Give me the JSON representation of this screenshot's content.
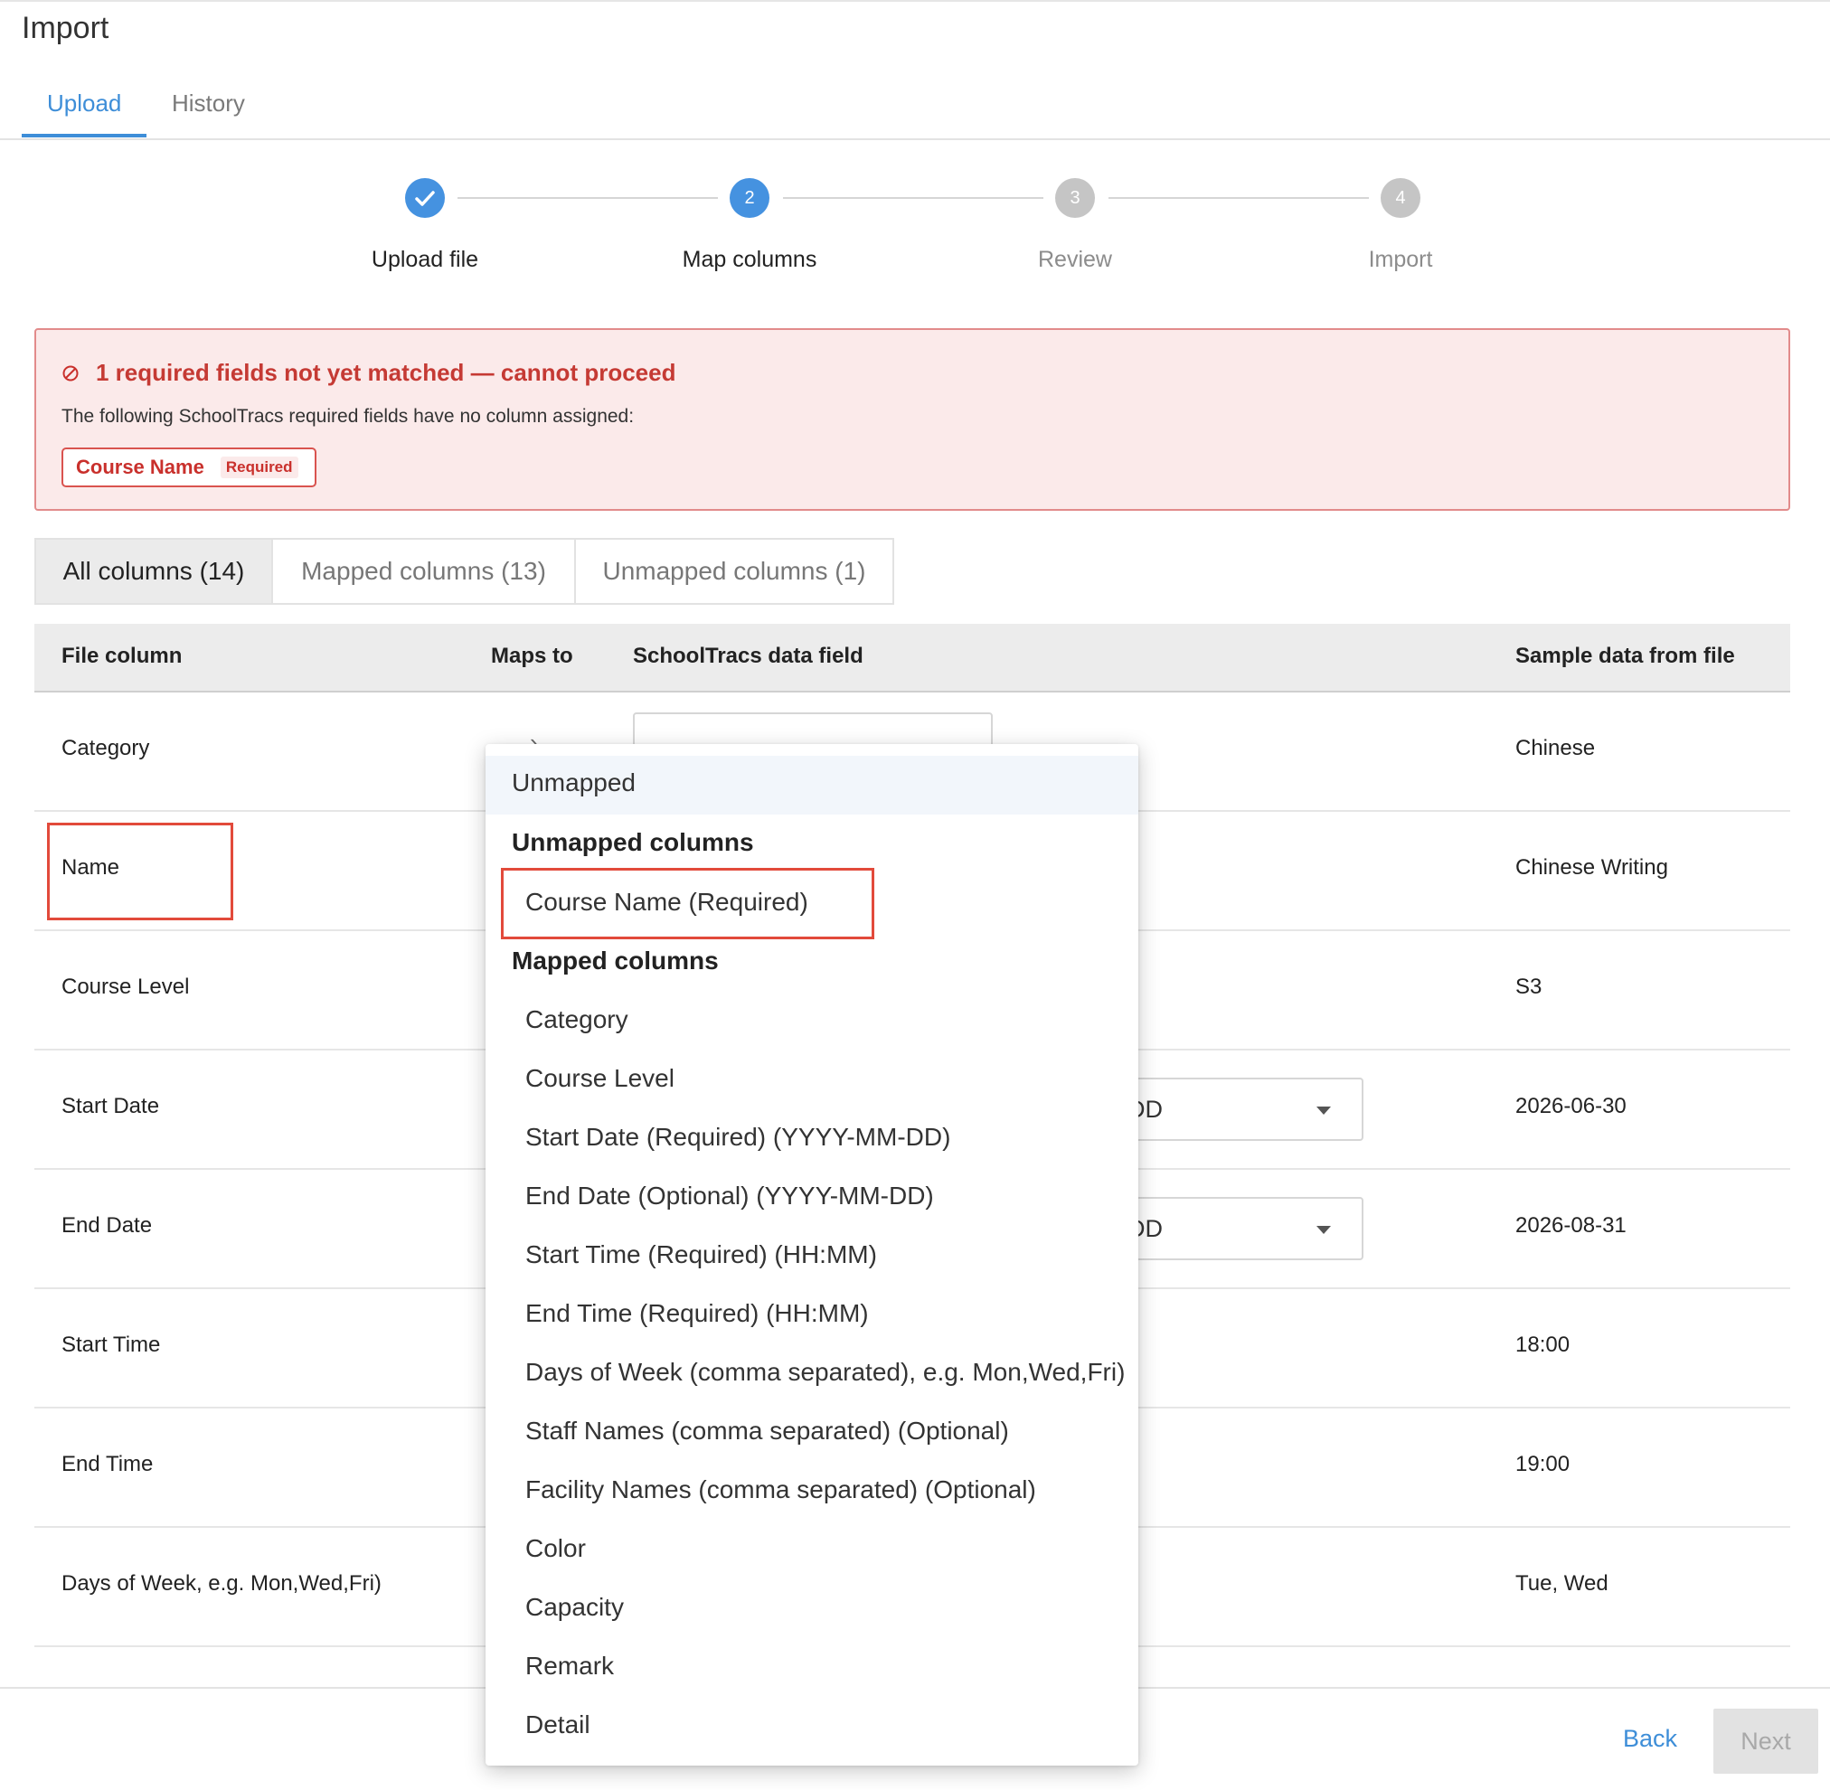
{
  "page": {
    "title": "Import"
  },
  "tabs": {
    "upload": "Upload",
    "history": "History"
  },
  "stepper": {
    "steps": [
      {
        "label": "Upload file",
        "number": "1",
        "state": "done"
      },
      {
        "label": "Map columns",
        "number": "2",
        "state": "current"
      },
      {
        "label": "Review",
        "number": "3",
        "state": "todo"
      },
      {
        "label": "Import",
        "number": "4",
        "state": "todo"
      }
    ]
  },
  "alert": {
    "icon": "ban-icon",
    "title": "1 required fields not yet matched — cannot proceed",
    "description": "The following SchoolTracs required fields have no column assigned:",
    "chip_name": "Course Name",
    "chip_badge": "Required"
  },
  "filters": {
    "all": "All columns (14)",
    "mapped": "Mapped columns (13)",
    "unmapped": "Unmapped columns (1)"
  },
  "table": {
    "headers": {
      "file_column": "File column",
      "maps_to": "Maps to",
      "data_field": "SchoolTracs data field",
      "sample": "Sample data from file"
    },
    "rows": [
      {
        "file": "Category",
        "sample": "Chinese",
        "field_text": ""
      },
      {
        "file": "Name",
        "sample": "Chinese Writing",
        "field_text": ""
      },
      {
        "file": "Course Level",
        "sample": "S3",
        "field_text": ""
      },
      {
        "file": "Start Date",
        "sample": "2026-06-30",
        "field_text": "-DD"
      },
      {
        "file": "End Date",
        "sample": "2026-08-31",
        "field_text": "-DD"
      },
      {
        "file": "Start Time",
        "sample": "18:00",
        "field_text": ""
      },
      {
        "file": "End Time",
        "sample": "19:00",
        "field_text": ""
      },
      {
        "file": "Days of Week, e.g. Mon,Wed,Fri)",
        "sample": "Tue, Wed",
        "field_text": ""
      }
    ]
  },
  "dropdown": {
    "selected": "Unmapped",
    "group_unmapped": "Unmapped columns",
    "unmapped_options": [
      "Course Name (Required)"
    ],
    "group_mapped": "Mapped columns",
    "mapped_options": [
      "Category",
      "Course Level",
      "Start Date (Required) (YYYY-MM-DD)",
      "End Date (Optional) (YYYY-MM-DD)",
      "Start Time (Required) (HH:MM)",
      "End Time (Required) (HH:MM)",
      "Days of Week (comma separated), e.g. Mon,Wed,Fri)",
      "Staff Names (comma separated) (Optional)",
      "Facility Names (comma separated) (Optional)",
      "Color",
      "Capacity",
      "Remark",
      "Detail"
    ]
  },
  "footer": {
    "back": "Back",
    "next": "Next"
  },
  "colors": {
    "accent": "#3e8ed8",
    "error": "#c9302c",
    "highlight": "#e24a3b"
  }
}
